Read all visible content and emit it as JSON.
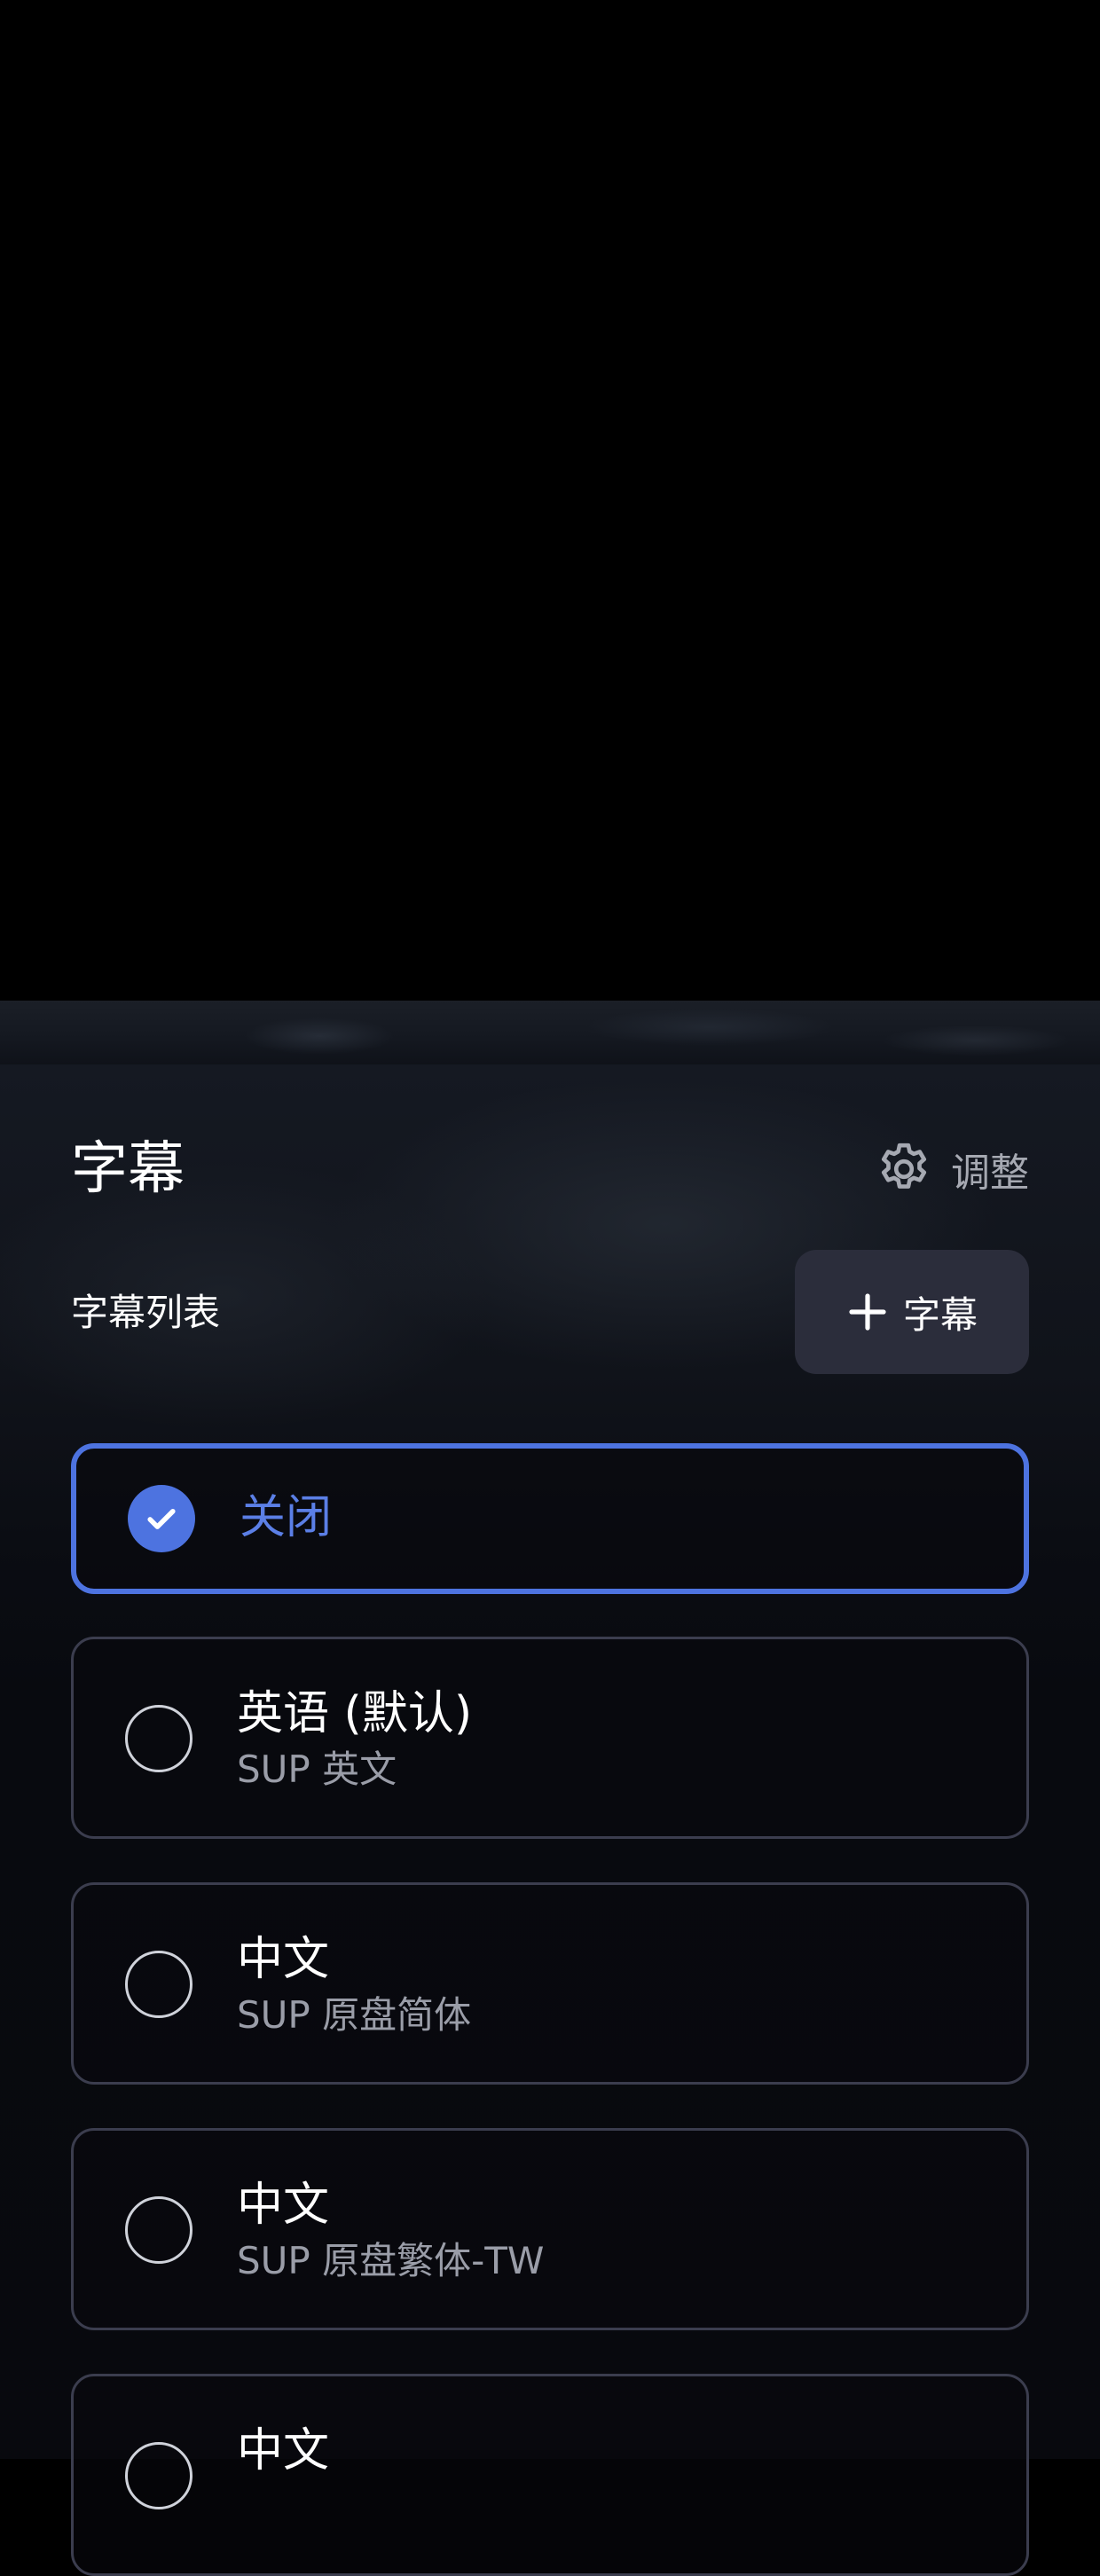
{
  "header": {
    "title": "字幕",
    "adjust_label": "调整",
    "adjust_icon": "gear-icon"
  },
  "list": {
    "label": "字幕列表",
    "add_button_label": "字幕",
    "add_button_icon": "plus-icon"
  },
  "options": [
    {
      "title": "关闭",
      "subtitle": "",
      "selected": true
    },
    {
      "title": "英语 (默认)",
      "subtitle": "SUP 英文",
      "selected": false
    },
    {
      "title": "中文",
      "subtitle": "SUP 原盘简体",
      "selected": false
    },
    {
      "title": "中文",
      "subtitle": "SUP 原盘繁体-TW",
      "selected": false
    },
    {
      "title": "中文",
      "subtitle": "",
      "selected": false
    }
  ],
  "colors": {
    "accent": "#4d73e0",
    "sheet_bg": "#08090e",
    "option_border": "#3b3d4e",
    "button_bg": "#2b2d3b",
    "muted_text": "#9a9da8"
  }
}
